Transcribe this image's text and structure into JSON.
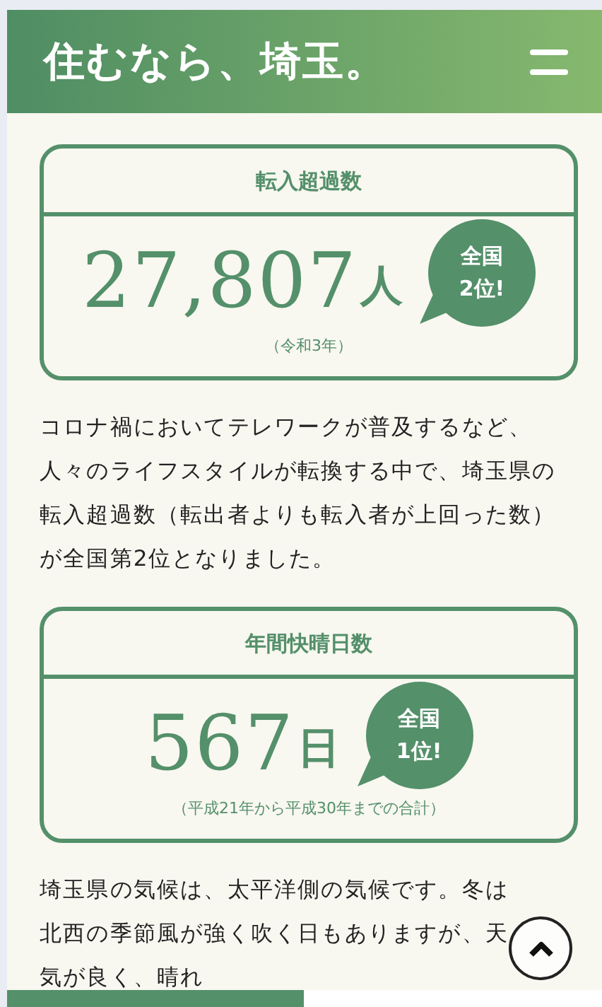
{
  "header": {
    "title": "住むなら、埼玉。"
  },
  "stats": [
    {
      "title": "転入超過数",
      "value": "27,807",
      "unit": "人",
      "rank": [
        "全国",
        "2位!"
      ],
      "note": "（令和3年）",
      "text": "コロナ禍においてテレワークが普及するなど、人々のライフスタイルが転換する中で、埼玉県の転入超過数（転出者よりも転入者が上回った数）が全国第2位となりました。"
    },
    {
      "title": "年間快晴日数",
      "value": "567",
      "unit": "日",
      "rank": [
        "全国",
        "1位!"
      ],
      "note": "（平成21年から平成30年までの合計）",
      "text": "埼玉県の気候は、太平洋側の気候です。冬は北西の季節風が強く吹く日もありますが、天気が良く、晴れ"
    }
  ]
}
